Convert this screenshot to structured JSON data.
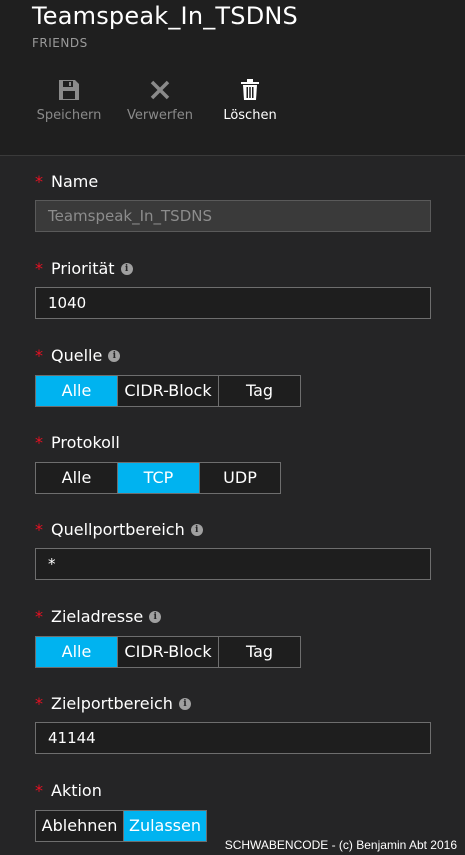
{
  "header": {
    "title": "Teamspeak_In_TSDNS",
    "subtitle": "FRIENDS"
  },
  "toolbar": {
    "save_label": "Speichern",
    "discard_label": "Verwerfen",
    "delete_label": "Löschen"
  },
  "fields": {
    "name": {
      "label": "Name",
      "value": "Teamspeak_In_TSDNS"
    },
    "priority": {
      "label": "Priorität",
      "value": "1040"
    },
    "source": {
      "label": "Quelle",
      "options": [
        "Alle",
        "CIDR-Block",
        "Tag"
      ],
      "selected": "Alle"
    },
    "protocol": {
      "label": "Protokoll",
      "options": [
        "Alle",
        "TCP",
        "UDP"
      ],
      "selected": "TCP"
    },
    "source_port_range": {
      "label": "Quellportbereich",
      "value": "*"
    },
    "destination": {
      "label": "Zieladresse",
      "options": [
        "Alle",
        "CIDR-Block",
        "Tag"
      ],
      "selected": "Alle"
    },
    "destination_port_range": {
      "label": "Zielportbereich",
      "value": "41144"
    },
    "action": {
      "label": "Aktion",
      "options": [
        "Ablehnen",
        "Zulassen"
      ],
      "selected": "Zulassen"
    }
  },
  "required_marker": "*",
  "footer": {
    "copyright": "SCHWABENCODE - (c) Benjamin Abt 2016"
  },
  "colors": {
    "accent": "#00b3f0",
    "required": "#e81123",
    "background": "#252526"
  },
  "icons": {
    "save": "floppy-disk-icon",
    "discard": "x-icon",
    "delete": "trash-icon",
    "info": "info-icon"
  }
}
